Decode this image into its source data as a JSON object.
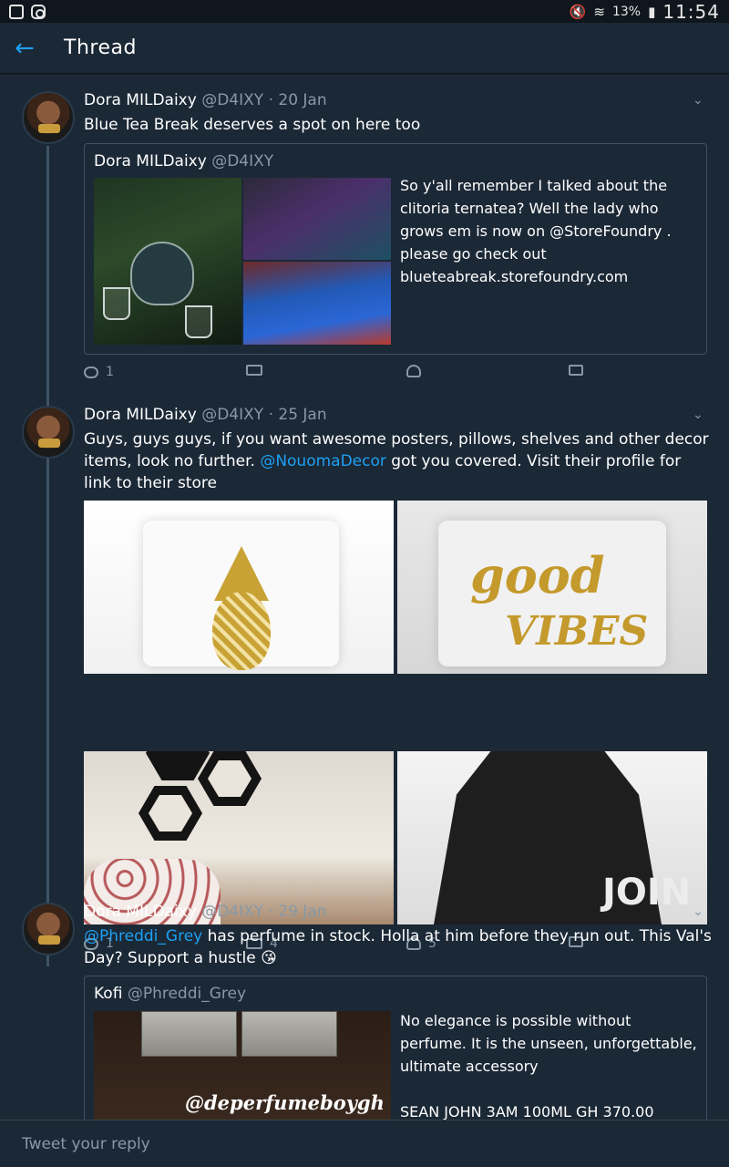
{
  "status_bar": {
    "battery": "13%",
    "time": "11:54"
  },
  "header": {
    "back_label": "←",
    "title": "Thread"
  },
  "tweets": [
    {
      "name": "Dora MILDaixy",
      "meta": "@D4IXY · 20 Jan",
      "text": "Blue Tea Break deserves a spot on here too",
      "quote": {
        "name": "Dora MILDaixy",
        "handle": "@D4IXY",
        "text": "So y'all remember I talked about the clitoria ternatea? Well the lady who grows em is now on @StoreFoundry . please go check out blueteabreak.storefoundry.com"
      },
      "actions": {
        "replies": "1",
        "retweets": "",
        "likes": ""
      }
    },
    {
      "name": "Dora MILDaixy",
      "meta": "@D4IXY · 25 Jan",
      "text_before": "Guys, guys guys, if you want awesome posters, pillows, shelves and other decor items, look no further. ",
      "mention": "@NouomaDecor",
      "text_after": " got you covered. Visit their profile for link to their store",
      "images": {
        "good_line1": "good",
        "good_line2": "VIBES",
        "vader_line": "JOIN"
      },
      "actions": {
        "replies": "1",
        "retweets": "4",
        "likes": "5"
      }
    },
    {
      "name": "Dora MILDaixy",
      "meta": "@D4IXY · 29 Jan",
      "mention": "@Phreddi_Grey",
      "text_after": " has perfume in stock. Holla at him before they run out. This Val's Day? Support a hustle 😘",
      "quote": {
        "name": "Kofi",
        "handle": "@Phreddi_Grey",
        "text": "No elegance is possible without perfume. It is the unseen, unforgettable, ultimate accessory\n\nSEAN JOHN 3AM 100ML GH 370.00",
        "watermark": "@deperfumeboygh"
      }
    }
  ],
  "reply": {
    "placeholder": "Tweet your reply"
  }
}
